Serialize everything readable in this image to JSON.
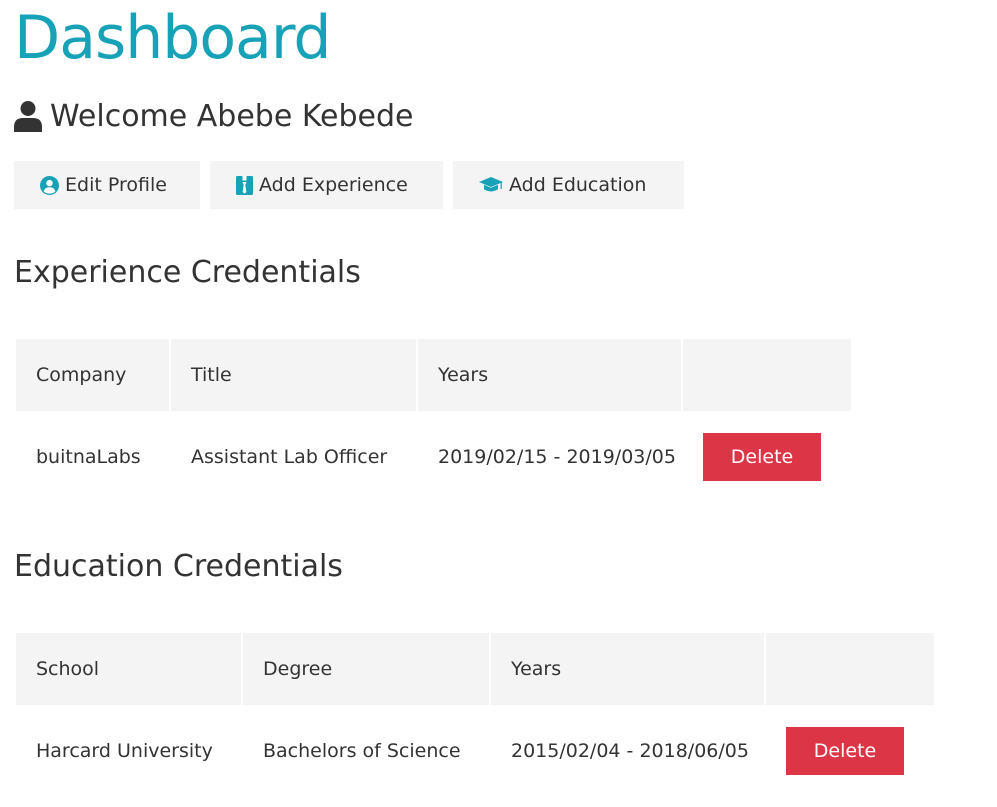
{
  "header": {
    "title": "Dashboard",
    "welcome_text": "Welcome Abebe Kebede",
    "welcome_icon": "user-icon"
  },
  "actions": {
    "edit_profile": {
      "label": "Edit Profile",
      "icon": "user-circle-icon"
    },
    "add_experience": {
      "label": "Add Experience",
      "icon": "id-badge-icon"
    },
    "add_education": {
      "label": "Add Education",
      "icon": "graduation-cap-icon"
    }
  },
  "experience": {
    "heading": "Experience Credentials",
    "columns": [
      "Company",
      "Title",
      "Years",
      ""
    ],
    "rows": [
      {
        "company": "buitnaLabs",
        "title": "Assistant Lab Officer",
        "years": "2019/02/15 - 2019/03/05",
        "action": "Delete"
      }
    ]
  },
  "education": {
    "heading": "Education Credentials",
    "columns": [
      "School",
      "Degree",
      "Years",
      ""
    ],
    "rows": [
      {
        "school": "Harcard University",
        "degree": "Bachelors of Science",
        "years": "2015/02/04 - 2018/06/05",
        "action": "Delete"
      }
    ]
  },
  "colors": {
    "primary": "#17a2b8",
    "danger": "#dc3545",
    "light": "#f4f4f4",
    "text": "#333333"
  }
}
